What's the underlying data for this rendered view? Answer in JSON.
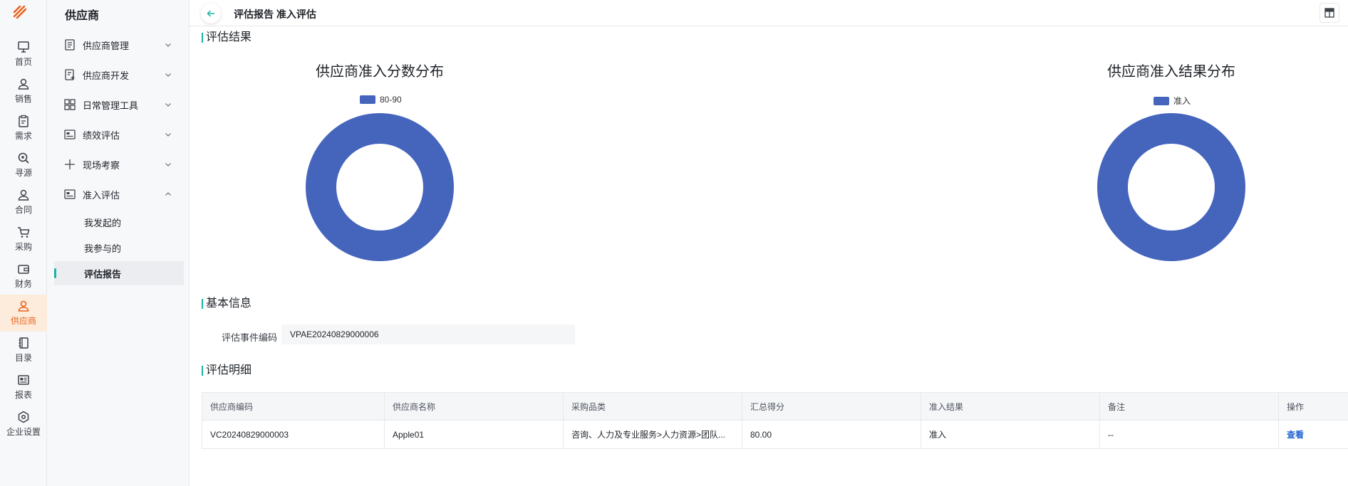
{
  "rail": {
    "items": [
      {
        "label": "首页",
        "icon": "monitor-icon"
      },
      {
        "label": "销售",
        "icon": "user-icon"
      },
      {
        "label": "需求",
        "icon": "clipboard-icon"
      },
      {
        "label": "寻源",
        "icon": "search-icon"
      },
      {
        "label": "合同",
        "icon": "user-icon"
      },
      {
        "label": "采购",
        "icon": "cart-icon"
      },
      {
        "label": "财务",
        "icon": "wallet-icon"
      },
      {
        "label": "供应商",
        "icon": "user-icon"
      },
      {
        "label": "目录",
        "icon": "book-icon"
      },
      {
        "label": "报表",
        "icon": "report-icon"
      },
      {
        "label": "企业设置",
        "icon": "hexagon-icon"
      }
    ]
  },
  "menu": {
    "title": "供应商",
    "groups": [
      {
        "label": "供应商管理"
      },
      {
        "label": "供应商开发"
      },
      {
        "label": "日常管理工具"
      },
      {
        "label": "绩效评估"
      },
      {
        "label": "现场考察"
      },
      {
        "label": "准入评估"
      }
    ],
    "sub_items": [
      {
        "label": "我发起的"
      },
      {
        "label": "我参与的"
      },
      {
        "label": "评估报告"
      }
    ]
  },
  "header": {
    "breadcrumb": "评估报告 准入评估"
  },
  "sections": {
    "result": "评估结果",
    "basic": "基本信息",
    "detail": "评估明细"
  },
  "chart_data": [
    {
      "type": "pie",
      "title": "供应商准入分数分布",
      "categories": [
        "80-90"
      ],
      "values": [
        1
      ],
      "legend": "top",
      "color": "#4565bd"
    },
    {
      "type": "pie",
      "title": "供应商准入结果分布",
      "categories": [
        "准入"
      ],
      "values": [
        1
      ],
      "legend": "top",
      "color": "#4565bd"
    }
  ],
  "basic_info": {
    "event_code_label": "评估事件编码",
    "event_code_value": "VPAE20240829000006"
  },
  "table": {
    "headers": [
      "供应商编码",
      "供应商名称",
      "采购品类",
      "汇总得分",
      "准入结果",
      "备注",
      "操作"
    ],
    "rows": [
      [
        "VC20240829000003",
        "Apple01",
        "咨询、人力及专业服务>人力资源>团队...",
        "80.00",
        "准入",
        "--",
        "查看"
      ]
    ]
  },
  "colors": {
    "accent": "#18b5a5",
    "brand": "#e8631d",
    "chart": "#4565bd",
    "link": "#1e63d2"
  }
}
